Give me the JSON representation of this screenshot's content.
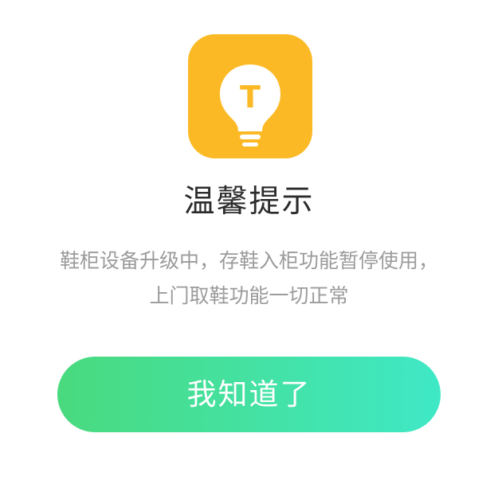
{
  "dialog": {
    "icon": "lightbulb-icon",
    "icon_letter": "T",
    "title": "温馨提示",
    "message_lines": [
      "鞋柜设备升级中，存鞋入柜功能暂停使用，",
      "上门取鞋功能一切正常"
    ],
    "confirm_label": "我知道了"
  },
  "colors": {
    "icon_background": "#FBBA25",
    "button_gradient_start": "#49DA7E",
    "button_gradient_end": "#3FE8C6",
    "title_text": "#2b2b2b",
    "message_text": "#9b9b9b"
  }
}
